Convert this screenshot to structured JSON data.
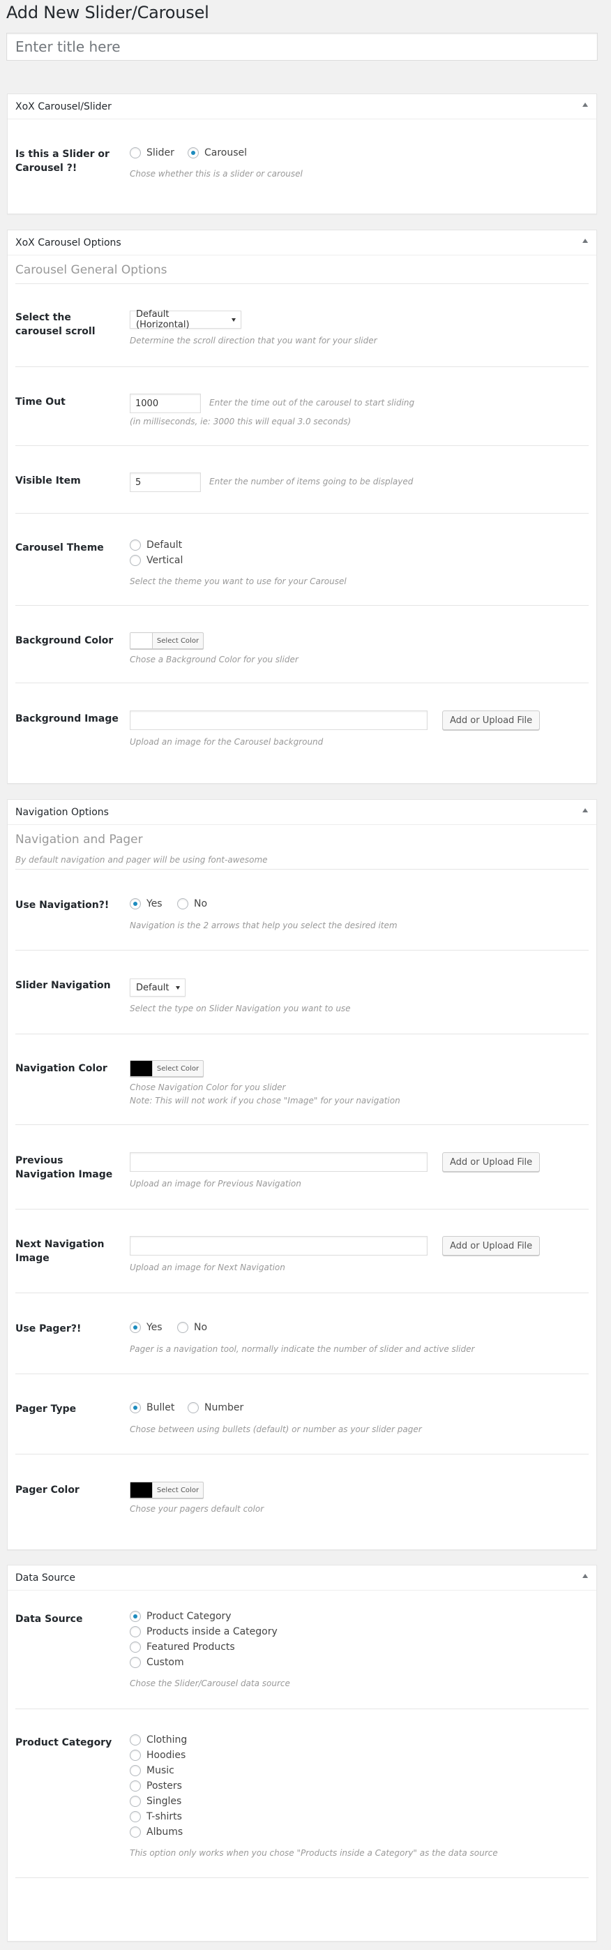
{
  "page": {
    "title": "Add New Slider/Carousel",
    "title_placeholder": "Enter title here"
  },
  "boxes": {
    "type_box": {
      "title": "XoX Carousel/Slider",
      "label": "Is this a Slider or Carousel ?!",
      "options": [
        "Slider",
        "Carousel"
      ],
      "selected": "Carousel",
      "desc": "Chose whether this is a slider or carousel"
    },
    "carousel_options": {
      "title": "XoX Carousel Options",
      "section_title": "Carousel General Options",
      "scroll": {
        "label": "Select the carousel scroll",
        "value": "Default (Horizontal)",
        "desc": "Determine the scroll direction that you want for your slider"
      },
      "timeout": {
        "label": "Time Out",
        "value": "1000",
        "hint": "Enter the time out of the carousel to start sliding",
        "desc": "(in milliseconds, ie: 3000 this will equal 3.0 seconds)"
      },
      "visible": {
        "label": "Visible Item",
        "value": "5",
        "hint": "Enter the number of items going to be displayed"
      },
      "theme": {
        "label": "Carousel Theme",
        "options": [
          "Default",
          "Vertical"
        ],
        "selected": "",
        "desc": "Select the theme you want to use for your Carousel"
      },
      "bg_color": {
        "label": "Background Color",
        "button": "Select Color",
        "color": "#ffffff",
        "desc": "Chose a Background Color for you slider"
      },
      "bg_image": {
        "label": "Background Image",
        "button": "Add or Upload File",
        "desc": "Upload an image for the Carousel background"
      }
    },
    "navigation": {
      "title": "Navigation Options",
      "section_title": "Navigation and Pager",
      "section_sub": "By default navigation and pager will be using font-awesome",
      "use_nav": {
        "label": "Use Navigation?!",
        "options": [
          "Yes",
          "No"
        ],
        "selected": "Yes",
        "desc": "Navigation is the 2 arrows that help you select the desired item"
      },
      "slider_nav": {
        "label": "Slider Navigation",
        "value": "Default",
        "desc": "Select the type on Slider Navigation you want to use"
      },
      "nav_color": {
        "label": "Navigation Color",
        "button": "Select Color",
        "color": "#000000",
        "desc": "Chose Navigation Color for you slider",
        "note": "Note: This will not work if you chose \"Image\" for your navigation"
      },
      "prev_image": {
        "label": "Previous Navigation Image",
        "button": "Add or Upload File",
        "desc": "Upload an image for Previous Navigation"
      },
      "next_image": {
        "label": "Next Navigation Image",
        "button": "Add or Upload File",
        "desc": "Upload an image for Next Navigation"
      },
      "use_pager": {
        "label": "Use Pager?!",
        "options": [
          "Yes",
          "No"
        ],
        "selected": "Yes",
        "desc": "Pager is a navigation tool, normally indicate the number of slider and active slider"
      },
      "pager_type": {
        "label": "Pager Type",
        "options": [
          "Bullet",
          "Number"
        ],
        "selected": "Bullet",
        "desc": "Chose between using bullets (default) or number as your slider pager"
      },
      "pager_color": {
        "label": "Pager Color",
        "button": "Select Color",
        "color": "#000000",
        "desc": "Chose your pagers default color"
      }
    },
    "data_source": {
      "title": "Data Source",
      "source": {
        "label": "Data Source",
        "options": [
          "Product Category",
          "Products inside a Category",
          "Featured Products",
          "Custom"
        ],
        "selected": "Product Category",
        "desc": "Chose the Slider/Carousel data source"
      },
      "category": {
        "label": "Product Category",
        "options": [
          "Clothing",
          "Hoodies",
          "Music",
          "Posters",
          "Singles",
          "T-shirts",
          "Albums"
        ],
        "selected": "",
        "desc": "This option only works when you chose \"Products inside a Category\" as the data source"
      }
    }
  },
  "colors": {
    "accent": "#1e8cbe",
    "background": "#f1f1f1"
  }
}
